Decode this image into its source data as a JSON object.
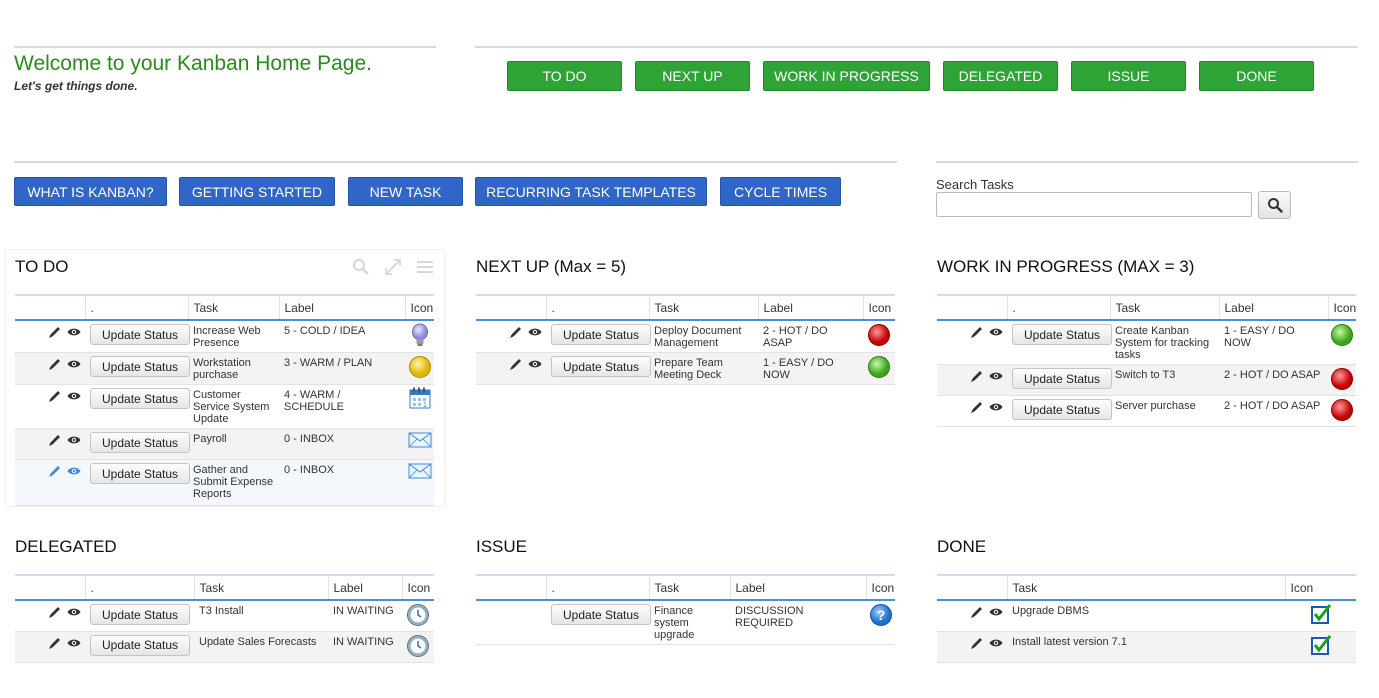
{
  "header": {
    "welcome": "Welcome to your Kanban Home Page.",
    "tagline": "Let's get things done."
  },
  "board_nav": {
    "buttons": [
      "TO DO",
      "NEXT UP",
      "WORK IN PROGRESS",
      "DELEGATED",
      "ISSUE",
      "DONE"
    ],
    "color": "#2fa436"
  },
  "menu": {
    "buttons": [
      "WHAT IS KANBAN?",
      "GETTING STARTED",
      "NEW TASK",
      "RECURRING TASK TEMPLATES",
      "CYCLE TIMES"
    ],
    "color": "#2f66c8"
  },
  "search": {
    "label": "Search Tasks",
    "value": "",
    "placeholder": ""
  },
  "common": {
    "update_label": "Update Status"
  },
  "panels": {
    "todo": {
      "title": "TO DO",
      "headers": [
        ".",
        "Task",
        "Label",
        "Icon"
      ],
      "rows": [
        {
          "task": "Increase Web Presence",
          "label": "5 - COLD / IDEA",
          "icon": "lightbulb-icon"
        },
        {
          "task": "Workstation purchase",
          "label": "3 - WARM / PLAN",
          "icon": "yellow-ball-icon"
        },
        {
          "task": "Customer Service System Update",
          "label": "4 - WARM / SCHEDULE",
          "icon": "calendar-icon"
        },
        {
          "task": "Payroll",
          "label": "0 - INBOX",
          "icon": "envelope-icon"
        },
        {
          "task": "Gather and Submit Expense Reports",
          "label": "0 - INBOX",
          "icon": "envelope-icon"
        }
      ]
    },
    "next_up": {
      "title": "NEXT UP (Max = 5)",
      "headers": [
        ".",
        "Task",
        "Label",
        "Icon"
      ],
      "rows": [
        {
          "task": "Deploy Document Management",
          "label": "2 - HOT / DO ASAP",
          "icon": "red-ball-icon"
        },
        {
          "task": "Prepare Team Meeting Deck",
          "label": "1 - EASY / DO NOW",
          "icon": "green-ball-icon"
        }
      ]
    },
    "wip": {
      "title": "WORK IN PROGRESS (MAX = 3)",
      "headers": [
        ".",
        "Task",
        "Label",
        "Icon"
      ],
      "rows": [
        {
          "task": "Create Kanban System for tracking tasks",
          "label": "1 - EASY / DO NOW",
          "icon": "green-ball-icon"
        },
        {
          "task": "Switch to T3",
          "label": "2 - HOT / DO ASAP",
          "icon": "red-ball-icon"
        },
        {
          "task": "Server purchase",
          "label": "2 - HOT / DO ASAP",
          "icon": "red-ball-icon"
        }
      ]
    },
    "delegated": {
      "title": "DELEGATED",
      "headers": [
        ".",
        "Task",
        "Label",
        "Icon"
      ],
      "rows": [
        {
          "task": "T3 Install",
          "label": "IN WAITING",
          "icon": "clock-icon"
        },
        {
          "task": "Update Sales Forecasts",
          "label": "IN WAITING",
          "icon": "clock-icon"
        }
      ]
    },
    "issue": {
      "title": "ISSUE",
      "headers": [
        ".",
        "Task",
        "Label",
        "Icon"
      ],
      "rows": [
        {
          "task": "Finance system upgrade",
          "label": "DISCUSSION REQUIRED",
          "icon": "question-icon"
        }
      ]
    },
    "done": {
      "title": "DONE",
      "headers": [
        "Task",
        "Icon"
      ],
      "rows": [
        {
          "task": "Upgrade DBMS",
          "icon": "checkbox-icon"
        },
        {
          "task": "Install latest version 7.1",
          "icon": "checkbox-icon"
        }
      ]
    }
  }
}
